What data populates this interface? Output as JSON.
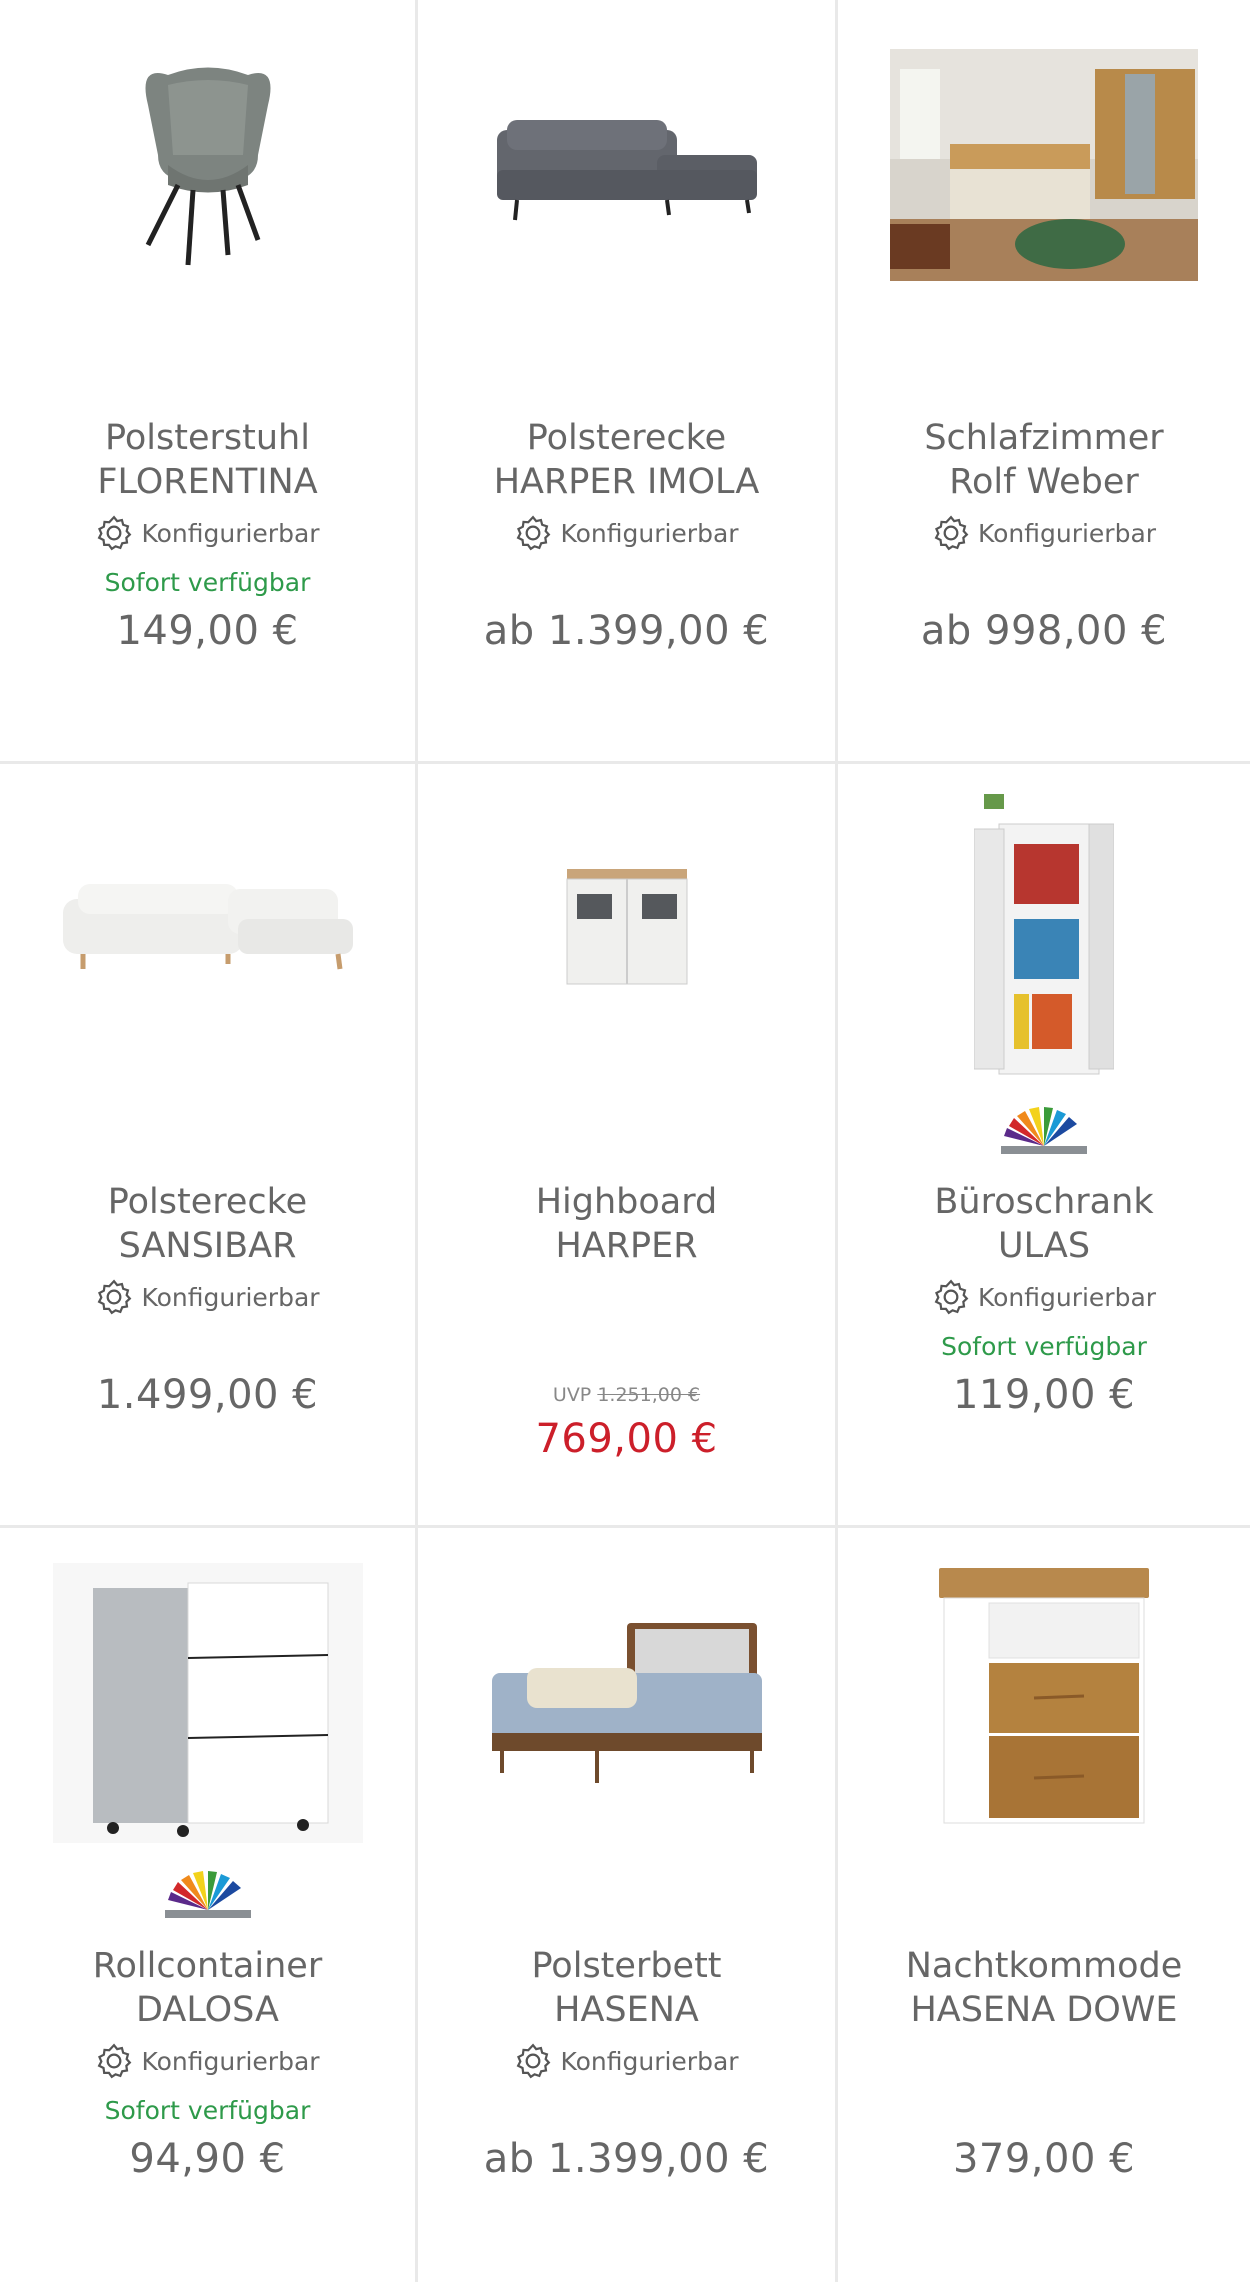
{
  "products": [
    {
      "title_line1": "Polsterstuhl",
      "title_line2": "FLORENTINA",
      "configurable": "Konfigurierbar",
      "availability": "Sofort verfügbar",
      "price": "149,00 €",
      "image": "grey-armchair"
    },
    {
      "title_line1": "Polsterecke",
      "title_line2": "HARPER IMOLA",
      "configurable": "Konfigurierbar",
      "price": "ab 1.399,00 €",
      "image": "grey-corner-sofa"
    },
    {
      "title_line1": "Schlafzimmer",
      "title_line2": "Rolf Weber",
      "configurable": "Konfigurierbar",
      "price": "ab 998,00 €",
      "image": "bedroom-scene"
    },
    {
      "title_line1": "Polsterecke",
      "title_line2": "SANSIBAR",
      "configurable": "Konfigurierbar",
      "price": "1.499,00 €",
      "image": "white-corner-sofa"
    },
    {
      "title_line1": "Highboard",
      "title_line2": "HARPER",
      "uvp_label": "UVP",
      "uvp_old_price": "1.251,00 €",
      "price": "769,00 €",
      "image": "white-highboard"
    },
    {
      "title_line1": "Büroschrank",
      "title_line2": "ULAS",
      "configurable": "Konfigurierbar",
      "availability": "Sofort verfügbar",
      "price": "119,00 €",
      "image": "office-cabinet",
      "color_swatch": "color-fan-icon"
    },
    {
      "title_line1": "Rollcontainer",
      "title_line2": "DALOSA",
      "configurable": "Konfigurierbar",
      "availability": "Sofort verfügbar",
      "price": "94,90 €",
      "image": "white-rolling-container",
      "color_swatch": "color-fan-icon"
    },
    {
      "title_line1": "Polsterbett",
      "title_line2": "HASENA",
      "configurable": "Konfigurierbar",
      "price": "ab 1.399,00 €",
      "image": "upholstered-bed"
    },
    {
      "title_line1": "Nachtkommode",
      "title_line2": "HASENA DOWE",
      "price": "379,00 €",
      "image": "nightstand"
    }
  ],
  "colors": {
    "text": "#666666",
    "available": "#2e9a4a",
    "sale": "#cc1f2a",
    "divider": "#e9e9e9"
  }
}
